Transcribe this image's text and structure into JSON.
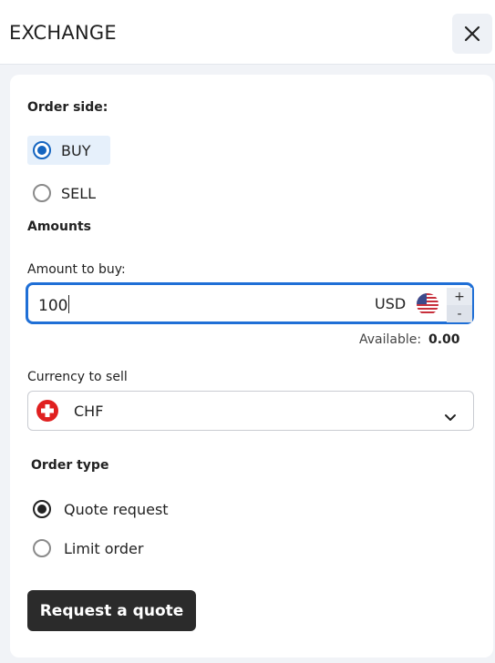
{
  "header": {
    "title": "EXCHANGE",
    "close_icon": "close-icon"
  },
  "order_side": {
    "label": "Order side:",
    "options": [
      {
        "label": "BUY",
        "selected": true
      },
      {
        "label": "SELL",
        "selected": false
      }
    ]
  },
  "amounts": {
    "heading": "Amounts",
    "amount_label": "Amount to buy:",
    "amount_value": "100",
    "currency": "USD",
    "currency_flag": "us-flag-icon",
    "increment": "+",
    "decrement": "-",
    "available_label": "Available:",
    "available_value": "0.00"
  },
  "currency_to_sell": {
    "label": "Currency to sell",
    "value": "CHF",
    "flag": "swiss-flag-icon"
  },
  "order_type": {
    "label": "Order type",
    "options": [
      {
        "label": "Quote request",
        "selected": true
      },
      {
        "label": "Limit order",
        "selected": false
      }
    ]
  },
  "actions": {
    "submit_label": "Request a quote"
  },
  "colors": {
    "accent": "#1f6fd6",
    "selected_bg": "#e6f0fb",
    "button_bg": "#2b2b2b",
    "swiss_red": "#e02020"
  }
}
